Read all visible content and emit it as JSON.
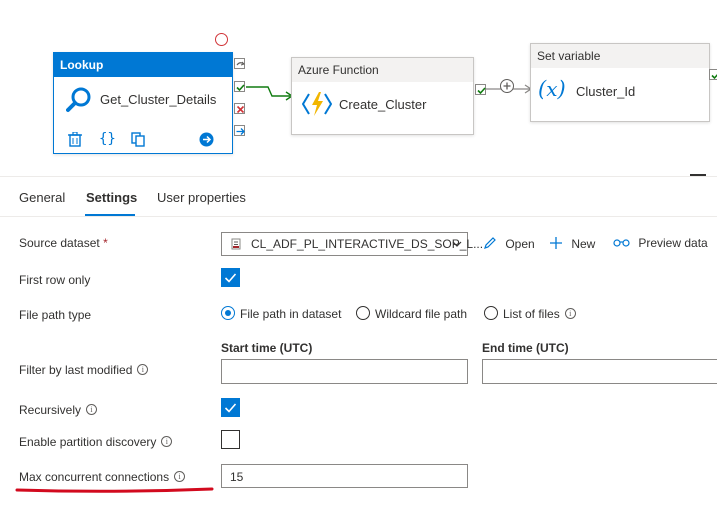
{
  "pipeline": {
    "lookup": {
      "type_label": "Lookup",
      "name": "Get_Cluster_Details"
    },
    "azure_function": {
      "type_label": "Azure Function",
      "name": "Create_Cluster"
    },
    "set_variable": {
      "type_label": "Set variable",
      "name": "Cluster_Id"
    }
  },
  "tabs": [
    {
      "label": "General"
    },
    {
      "label": "Settings"
    },
    {
      "label": "User properties"
    }
  ],
  "settings": {
    "source_dataset": {
      "label": "Source dataset",
      "required_mark": "*",
      "value": "CL_ADF_PL_INTERACTIVE_DS_SOP_L...",
      "open_label": "Open",
      "new_label": "New",
      "preview_label": "Preview data"
    },
    "first_row_only": {
      "label": "First row only",
      "checked": true
    },
    "file_path_type": {
      "label": "File path type",
      "options": [
        "File path in dataset",
        "Wildcard file path",
        "List of files"
      ],
      "selected": "File path in dataset"
    },
    "filter_last_modified": {
      "label": "Filter by last modified",
      "start_label": "Start time (UTC)",
      "end_label": "End time (UTC)",
      "start_value": "",
      "end_value": ""
    },
    "recursively": {
      "label": "Recursively",
      "checked": true
    },
    "partition_discovery": {
      "label": "Enable partition discovery",
      "checked": false
    },
    "max_connections": {
      "label": "Max concurrent connections",
      "value": "15"
    }
  },
  "colors": {
    "accent": "#0078d4",
    "success": "#107c10",
    "error": "#a4262c",
    "annotation": "#d20a1e"
  }
}
